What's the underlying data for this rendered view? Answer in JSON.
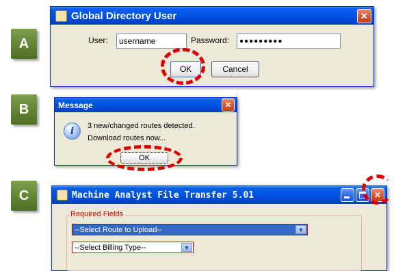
{
  "steps": {
    "a": "A",
    "b": "B",
    "c": "C"
  },
  "dialog_a": {
    "title": "Global Directory User",
    "user_label": "User:",
    "user_value": "username",
    "password_label": "Password:",
    "password_value": "●●●●●●●●●",
    "ok_label": "OK",
    "cancel_label": "Cancel",
    "close_symbol": "✕"
  },
  "dialog_b": {
    "title": "Message",
    "info_symbol": "i",
    "line1": "3 new/changed routes detected.",
    "line2": "Download routes now...",
    "ok_label": "OK",
    "close_symbol": "✕"
  },
  "dialog_c": {
    "title": "Machine Analyst File Transfer 5.01",
    "group_label": "Required Fields",
    "route_select": "--Select Route to Upload--",
    "billing_select": "--Select Billing Type--",
    "close_symbol": "✕",
    "arrow_symbol": "▼"
  },
  "colors": {
    "highlight_ring": "#dd0000",
    "step_badge": "#5f8230",
    "title_blue": "#0055e5",
    "close_red": "#d65a36"
  }
}
